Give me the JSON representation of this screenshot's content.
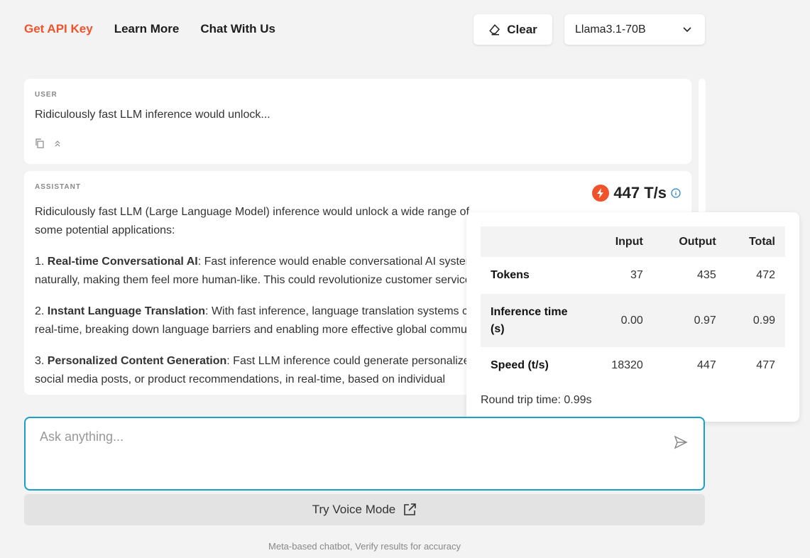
{
  "nav": {
    "get_api_key": "Get API Key",
    "learn_more": "Learn More",
    "chat_with_us": "Chat With Us"
  },
  "toolbar": {
    "clear_label": "Clear",
    "model": "Llama3.1-70B"
  },
  "user": {
    "role": "USER",
    "message": "Ridiculously fast LLM inference would unlock..."
  },
  "assistant": {
    "role": "ASSISTANT",
    "speed": "447 T/s",
    "lines": [
      {
        "text": "Ridiculously fast LLM (Large Language Model) inference would unlock a wide range of"
      },
      {
        "text": "some potential applications:"
      },
      {
        "num": "1. ",
        "bold": "Real-time Conversational AI",
        "text": ": Fast inference would enable conversational AI systems to respond"
      },
      {
        "text": "naturally, making them feel more human-like. This could revolutionize customer service"
      },
      {
        "num": "2. ",
        "bold": "Instant Language Translation",
        "text": ": With fast inference, language translation systems could"
      },
      {
        "text": "real-time, breaking down language barriers and enabling more effective global communication"
      },
      {
        "num": "3. ",
        "bold": "Personalized Content Generation",
        "text": ": Fast LLM inference could generate personalized"
      },
      {
        "text": "social media posts, or product recommendations, in real-time, based on individual"
      }
    ]
  },
  "stats": {
    "headers": [
      "",
      "Input",
      "Output",
      "Total"
    ],
    "rows": [
      [
        "Tokens",
        "37",
        "435",
        "472"
      ],
      [
        "Inference time (s)",
        "0.00",
        "0.97",
        "0.99"
      ],
      [
        "Speed (t/s)",
        "18320",
        "447",
        "477"
      ]
    ],
    "round_trip": "Round trip time: 0.99s"
  },
  "composer": {
    "placeholder": "Ask anything...",
    "voice": "Try Voice Mode"
  },
  "footer": "Meta-based chatbot, Verify results for accuracy",
  "colors": {
    "accent": "#f0532c",
    "focus": "#1a9fc9"
  }
}
